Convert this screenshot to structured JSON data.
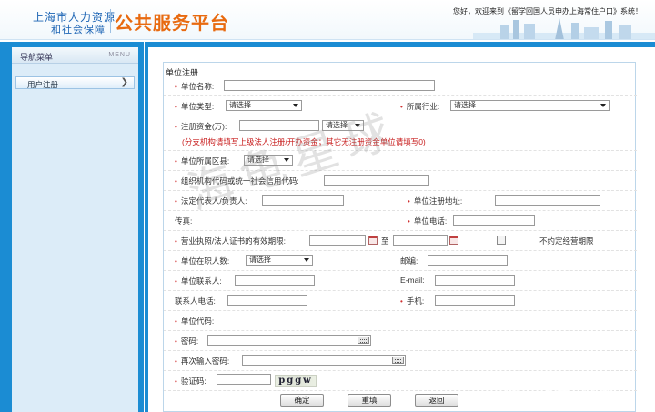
{
  "header": {
    "org_line1": "上海市人力资源",
    "org_line2": "和社会保障",
    "platform": "公共服务平台",
    "welcome": "您好，欢迎来到《留学回国人员申办上海常住户口》系统！"
  },
  "sidebar": {
    "title": "导航菜单",
    "title_en": "MENU",
    "items": [
      {
        "label": "用户注册",
        "icon": "chevron-right-icon"
      }
    ]
  },
  "form": {
    "legend": "单位注册",
    "company_name": {
      "label": "单位名称:",
      "value": ""
    },
    "company_type": {
      "label": "单位类型:",
      "selected": "请选择"
    },
    "industry": {
      "label": "所属行业:",
      "selected": "请选择"
    },
    "registered_capital": {
      "label": "注册资金(万):",
      "value": "",
      "selected": "请选择"
    },
    "capital_hint": "(分支机构请填写上级法人注册/开办资金；其它无注册资金单位请填写0)",
    "district": {
      "label": "单位所属区县:",
      "selected": "请选择"
    },
    "credit_code": {
      "label": "组织机构代码或统一社会信用代码:",
      "value": ""
    },
    "legal_rep": {
      "label": "法定代表人/负责人:",
      "value": ""
    },
    "registered_address": {
      "label": "单位注册地址:",
      "value": ""
    },
    "fax": {
      "label": "传真:",
      "value": ""
    },
    "company_phone": {
      "label": "单位电话:",
      "value": ""
    },
    "license_validity": {
      "label": "营业执照/法人证书的有效期限:",
      "to": "至",
      "indefinite": "不约定经营期限"
    },
    "employee_count": {
      "label": "单位在职人数:",
      "selected": "请选择"
    },
    "postcode": {
      "label": "邮编:",
      "value": ""
    },
    "contact_person": {
      "label": "单位联系人:",
      "value": ""
    },
    "email": {
      "label": "E-mail:",
      "value": ""
    },
    "contact_phone": {
      "label": "联系人电话:",
      "value": ""
    },
    "mobile": {
      "label": "手机:",
      "value": ""
    },
    "company_code": {
      "label": "单位代码:"
    },
    "password": {
      "label": "密码:",
      "value": ""
    },
    "password_confirm": {
      "label": "再次输入密码:",
      "value": ""
    },
    "captcha": {
      "label": "验证码:",
      "value": "",
      "image_text": "pggw"
    },
    "buttons": {
      "confirm": "确定",
      "reset": "重填",
      "back": "返回"
    }
  },
  "watermark": {
    "center": "海龟星球",
    "corner": "知乎 @海龟星球"
  },
  "colors": {
    "frame_blue": "#1b8cd3",
    "platform_orange": "#e86a10",
    "logo_blue": "#1c64b4",
    "required_red": "#d03030",
    "hint_red": "#c81e1e"
  }
}
